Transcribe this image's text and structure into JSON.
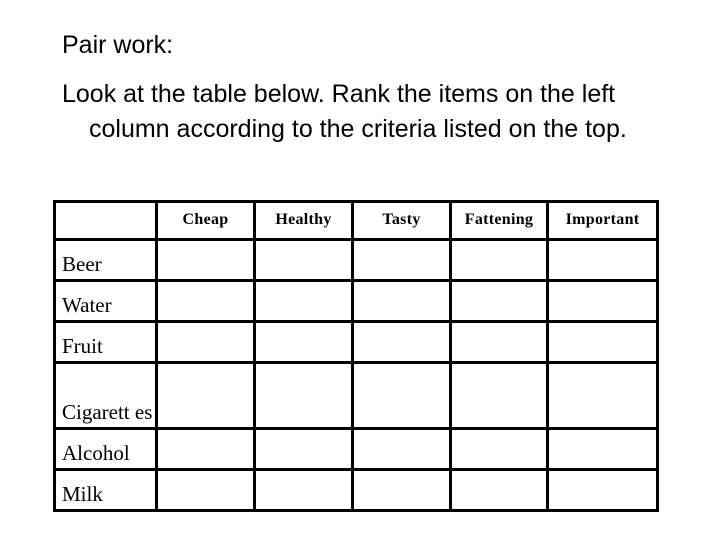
{
  "heading": "Pair work:",
  "instruction": "Look at the table below. Rank the items on the left column according to the criteria listed on the top.",
  "table": {
    "corner": "",
    "columns": [
      "Cheap",
      "Healthy",
      "Tasty",
      "Fattening",
      "Important"
    ],
    "rows": [
      {
        "item": "Beer",
        "values": [
          "",
          "",
          "",
          "",
          ""
        ]
      },
      {
        "item": "Water",
        "values": [
          "",
          "",
          "",
          "",
          ""
        ]
      },
      {
        "item": "Fruit",
        "values": [
          "",
          "",
          "",
          "",
          ""
        ]
      },
      {
        "item": "Cigarett es",
        "values": [
          "",
          "",
          "",
          "",
          ""
        ]
      },
      {
        "item": "Alcohol",
        "values": [
          "",
          "",
          "",
          "",
          ""
        ]
      },
      {
        "item": "Milk",
        "values": [
          "",
          "",
          "",
          "",
          ""
        ]
      }
    ]
  }
}
